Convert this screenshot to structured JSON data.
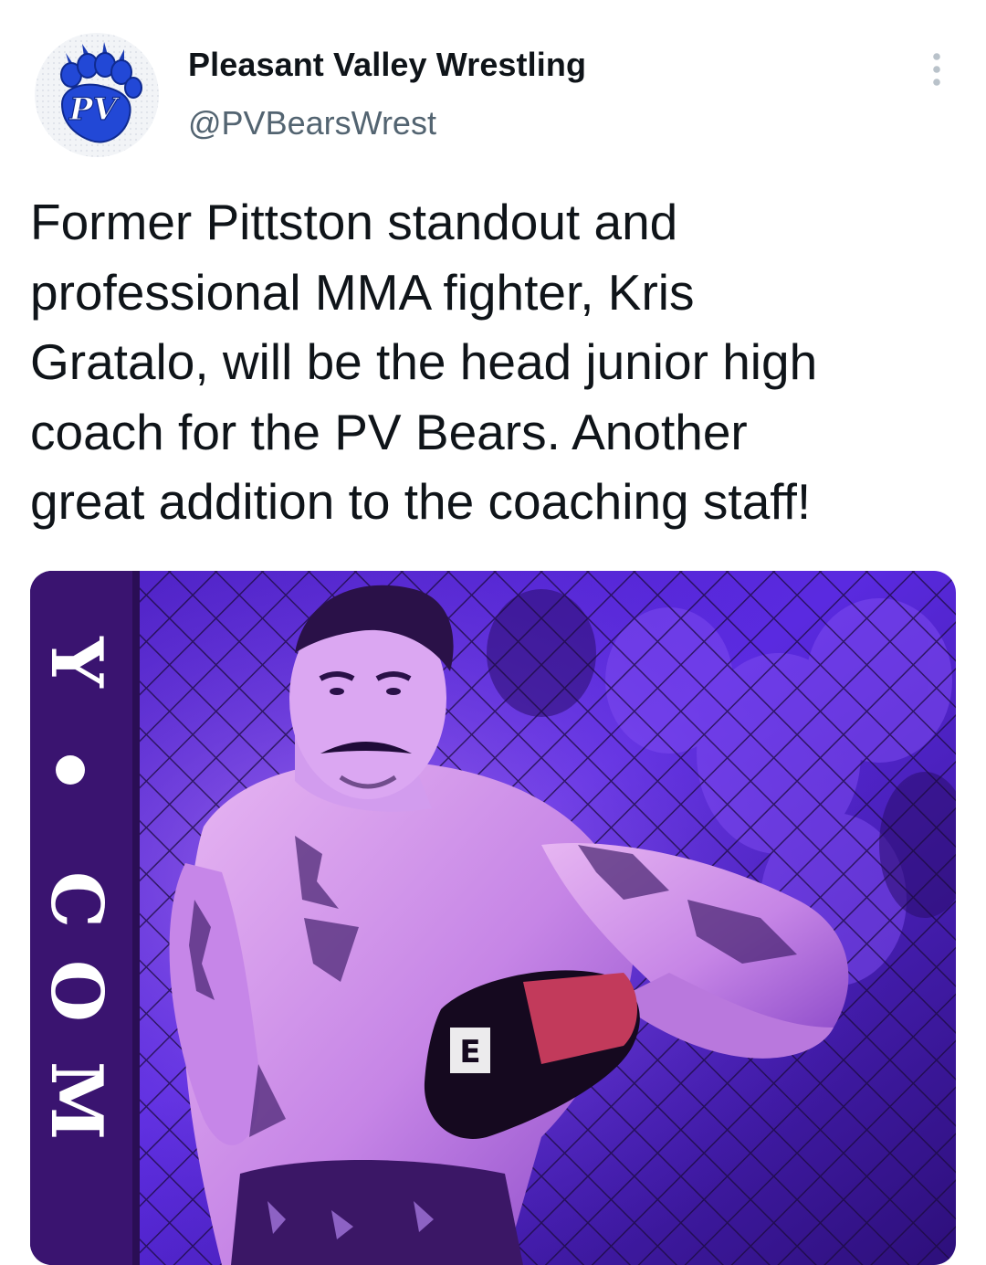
{
  "account": {
    "display_name": "Pleasant Valley Wrestling",
    "handle": "@PVBearsWrest",
    "avatar_logo_text": "PV"
  },
  "tweet": {
    "text": "Former Pittston standout and\nprofessional MMA fighter, Kris\nGratalo, will be the head junior high\ncoach for the PV Bears. Another\ngreat addition to the coaching staff!"
  },
  "media": {
    "banner_letters": "Y.COM",
    "glove_brand_mark": "E"
  },
  "icons": {
    "more": "more-vertical-icon",
    "avatar_logo": "bear-paw-logo"
  },
  "colors": {
    "text_primary": "#0f1419",
    "text_secondary": "#536471",
    "logo_blue": "#1f3fbf",
    "photo_purple": "#6a28d9"
  }
}
